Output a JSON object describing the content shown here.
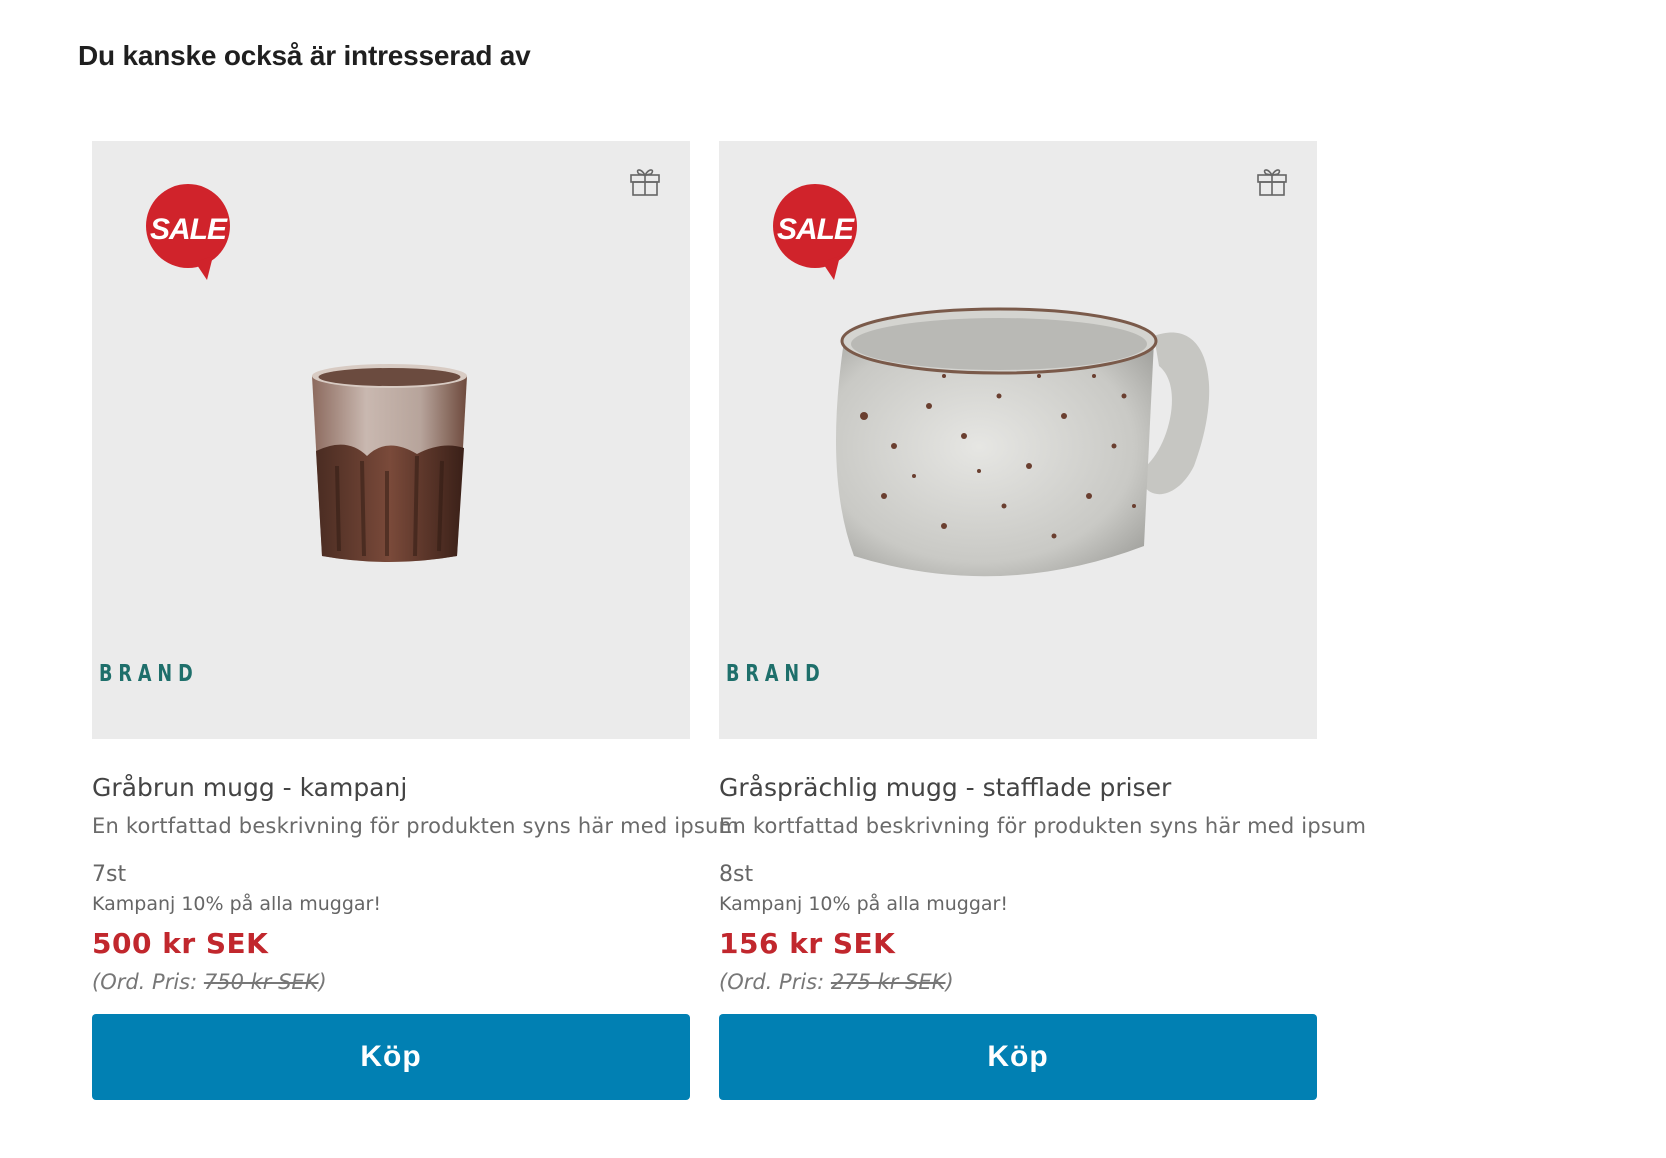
{
  "section": {
    "title": "Du kanske också är intresserad av"
  },
  "products": [
    {
      "badge": "SALE",
      "brand": "BRAND",
      "title": "Gråbrun mugg - kampanj",
      "description": "En kortfattad beskrivning för produkten syns här med ipsum",
      "stock": "7st",
      "campaign": "Kampanj 10% på alla muggar!",
      "price": "500 kr SEK",
      "ord_prefix": "(Ord. Pris: ",
      "ord_price": "750 kr SEK",
      "ord_suffix": ")",
      "buy_label": "Köp",
      "image": "brown-grey-cup",
      "wishlist_icon": "gift-icon"
    },
    {
      "badge": "SALE",
      "brand": "BRAND",
      "title": "Gråsprächlig mugg - stafflade priser",
      "description": "En kortfattad beskrivning för produkten syns här med ipsum",
      "stock": "8st",
      "campaign": "Kampanj 10% på alla muggar!",
      "price": "156 kr SEK",
      "ord_prefix": "(Ord. Pris: ",
      "ord_price": "275 kr SEK",
      "ord_suffix": ")",
      "buy_label": "Köp",
      "image": "speckled-grey-mug",
      "wishlist_icon": "gift-icon"
    }
  ],
  "colors": {
    "price": "#c1272d",
    "button": "#0180b3",
    "brand": "#1e6f6b",
    "sale_badge": "#d0232b",
    "media_bg": "#ebebeb"
  }
}
